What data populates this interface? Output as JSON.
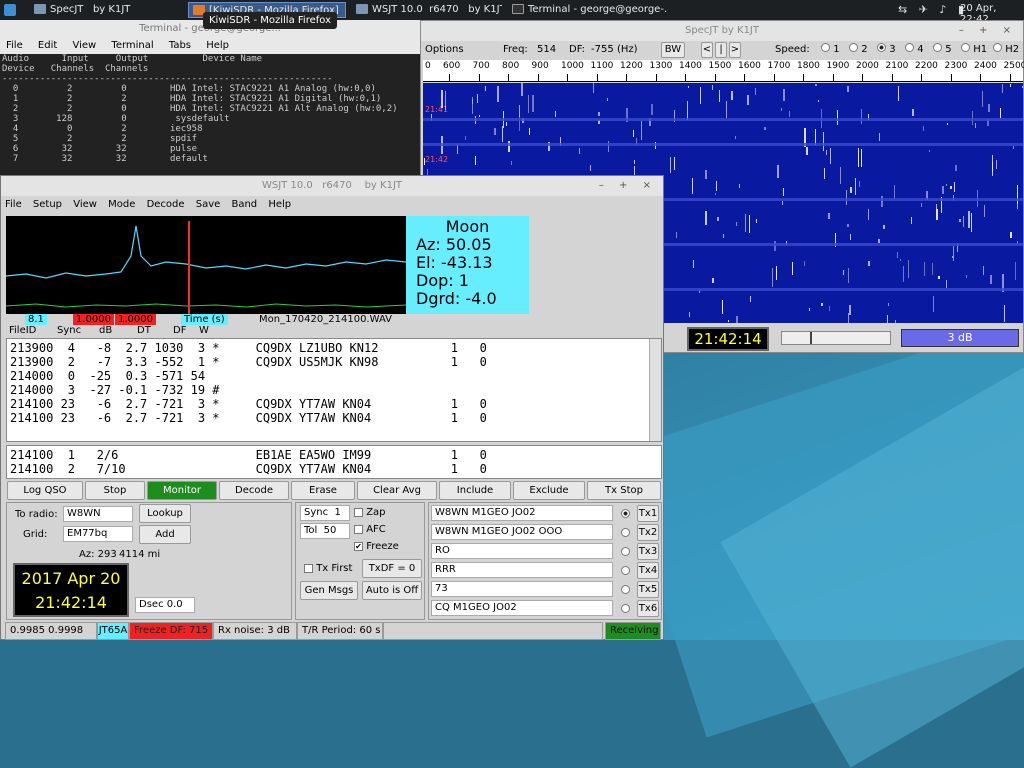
{
  "taskbar": {
    "specjt": "SpecJT",
    "specjt_by": "by K1JT",
    "kiwi": "[KiwiSDR - Mozilla Firefox]",
    "wsjt": "WSJT 10.0",
    "wsjt_rev": "r6470",
    "wsjt_by": "by K1JT",
    "terminal": "Terminal - george@george-...",
    "tooltip": "KiwiSDR - Mozilla Firefox",
    "date": "20 Apr, 22:42"
  },
  "terminal": {
    "title": "Terminal - george@george...",
    "menu": [
      "File",
      "Edit",
      "View",
      "Terminal",
      "Tabs",
      "Help"
    ],
    "lines": [
      "Audio      Input     Output          Device Name",
      "Device   Channels  Channels",
      "-------------------------------------------------------------",
      "  0         2         0        HDA Intel: STAC9221 A1 Analog (hw:0,0)",
      "  1         2         2        HDA Intel: STAC9221 A1 Digital (hw:0,1)",
      "  2         2         0        HDA Intel: STAC9221 A1 Alt Analog (hw:0,2)",
      "  3       128         0         sysdefault",
      "  4         0         2        iec958",
      "  5         2         2        spdif",
      "  6        32        32        pulse",
      "  7        32        32        default"
    ]
  },
  "specjt": {
    "title": "SpecJT    by K1JT",
    "options": "Options",
    "freq_label": "Freq:",
    "freq": "514",
    "df_label": "DF:",
    "df": "-755",
    "df_unit": "(Hz)",
    "bw": "BW",
    "nav": [
      "<",
      "|",
      ">"
    ],
    "speed_label": "Speed:",
    "speeds": [
      "1",
      "2",
      "3",
      "4",
      "5",
      "H1",
      "H2"
    ],
    "speed_selected": "3",
    "scale": [
      "600",
      "700",
      "800",
      "900",
      "1000",
      "1100",
      "1200",
      "1300",
      "1400",
      "1500",
      "1600",
      "1700",
      "1800",
      "1900",
      "2000",
      "2100",
      "2200",
      "2300",
      "2400",
      "2500"
    ],
    "scale0": "0",
    "clock": "21:42:14",
    "gain": "3 dB",
    "marker1": "21:41",
    "marker2": "21:42"
  },
  "wsjt": {
    "title": "WSJT 10.0",
    "rev": "r6470",
    "by": "by K1JT",
    "menu": [
      "File",
      "Setup",
      "View",
      "Mode",
      "Decode",
      "Save",
      "Band",
      "Help"
    ],
    "moon": {
      "title": "Moon",
      "az": "Az:  50.05",
      "el": "El: -43.13",
      "dop": "Dop:      1",
      "dgrd": "Dgrd: -4.0"
    },
    "plot_labels": {
      "a": "8.1",
      "b": "1.0000",
      "c": "1.0000",
      "time": "Time (s)",
      "file": "Mon_170420_214100.WAV"
    },
    "headers": [
      "FileID",
      "Sync",
      "dB",
      "DT",
      "DF",
      "W"
    ],
    "decodes": [
      "213900  4   -8  2.7 1030  3 *     CQ9DX LZ1UBO KN12          1   0",
      "213900  2   -7  3.3 -552  1 *     CQ9DX US5MJK KN98          1   0",
      "214000  0  -25  0.3 -571 54",
      "214000  3  -27 -0.1 -732 19 #",
      "214100 23   -6  2.7 -721  3 *     CQ9DX YT7AW KN04           1   0",
      "214100 23   -6  2.7 -721  3 *     CQ9DX YT7AW KN04           1   0"
    ],
    "decodes2": [
      "214100  1   2/6                   EB1AE EA5WO IM99           1   0",
      "214100  2   7/10                  CQ9DX YT7AW KN04           1   0"
    ],
    "buttons": [
      "Log QSO",
      "Stop",
      "Monitor",
      "Decode",
      "Erase",
      "Clear Avg",
      "Include",
      "Exclude",
      "Tx Stop"
    ],
    "to_radio_label": "To radio:",
    "to_radio": "W8WN",
    "lookup": "Lookup",
    "grid_label": "Grid:",
    "grid": "EM77bq",
    "add": "Add",
    "az": "Az: 293",
    "dist": "4114 mi",
    "date": "2017 Apr 20",
    "time": "21:42:14",
    "dsec": "Dsec  0.0",
    "sync_label": "Sync",
    "sync": "1",
    "tol_label": "Tol",
    "tol": "50",
    "zap": "Zap",
    "afc": "AFC",
    "freeze": "Freeze",
    "txfirst": "Tx First",
    "txdf": "TxDF = 0",
    "genmsgs": "Gen Msgs",
    "autooff": "Auto is Off",
    "tx_msgs": [
      "W8WN M1GEO JO02",
      "W8WN M1GEO JO02 OOO",
      "RO",
      "RRR",
      "73",
      "CQ M1GEO JO02"
    ],
    "tx_labels": [
      "Tx1",
      "Tx2",
      "Tx3",
      "Tx4",
      "Tx5",
      "Tx6"
    ],
    "status": {
      "vals": "0.9985 0.9998",
      "mode": "JT65A",
      "freeze": "Freeze DF: 715",
      "rxnoise": "Rx noise:  3 dB",
      "period": "T/R Period: 60 s",
      "receiving": "Receiving"
    }
  },
  "colors": {
    "accent": "#66eeff",
    "monitor": "#1e8c1e",
    "freeze": "#ee2222",
    "clock_fg": "#ffff33",
    "waterfall": "#0a1aa0"
  }
}
